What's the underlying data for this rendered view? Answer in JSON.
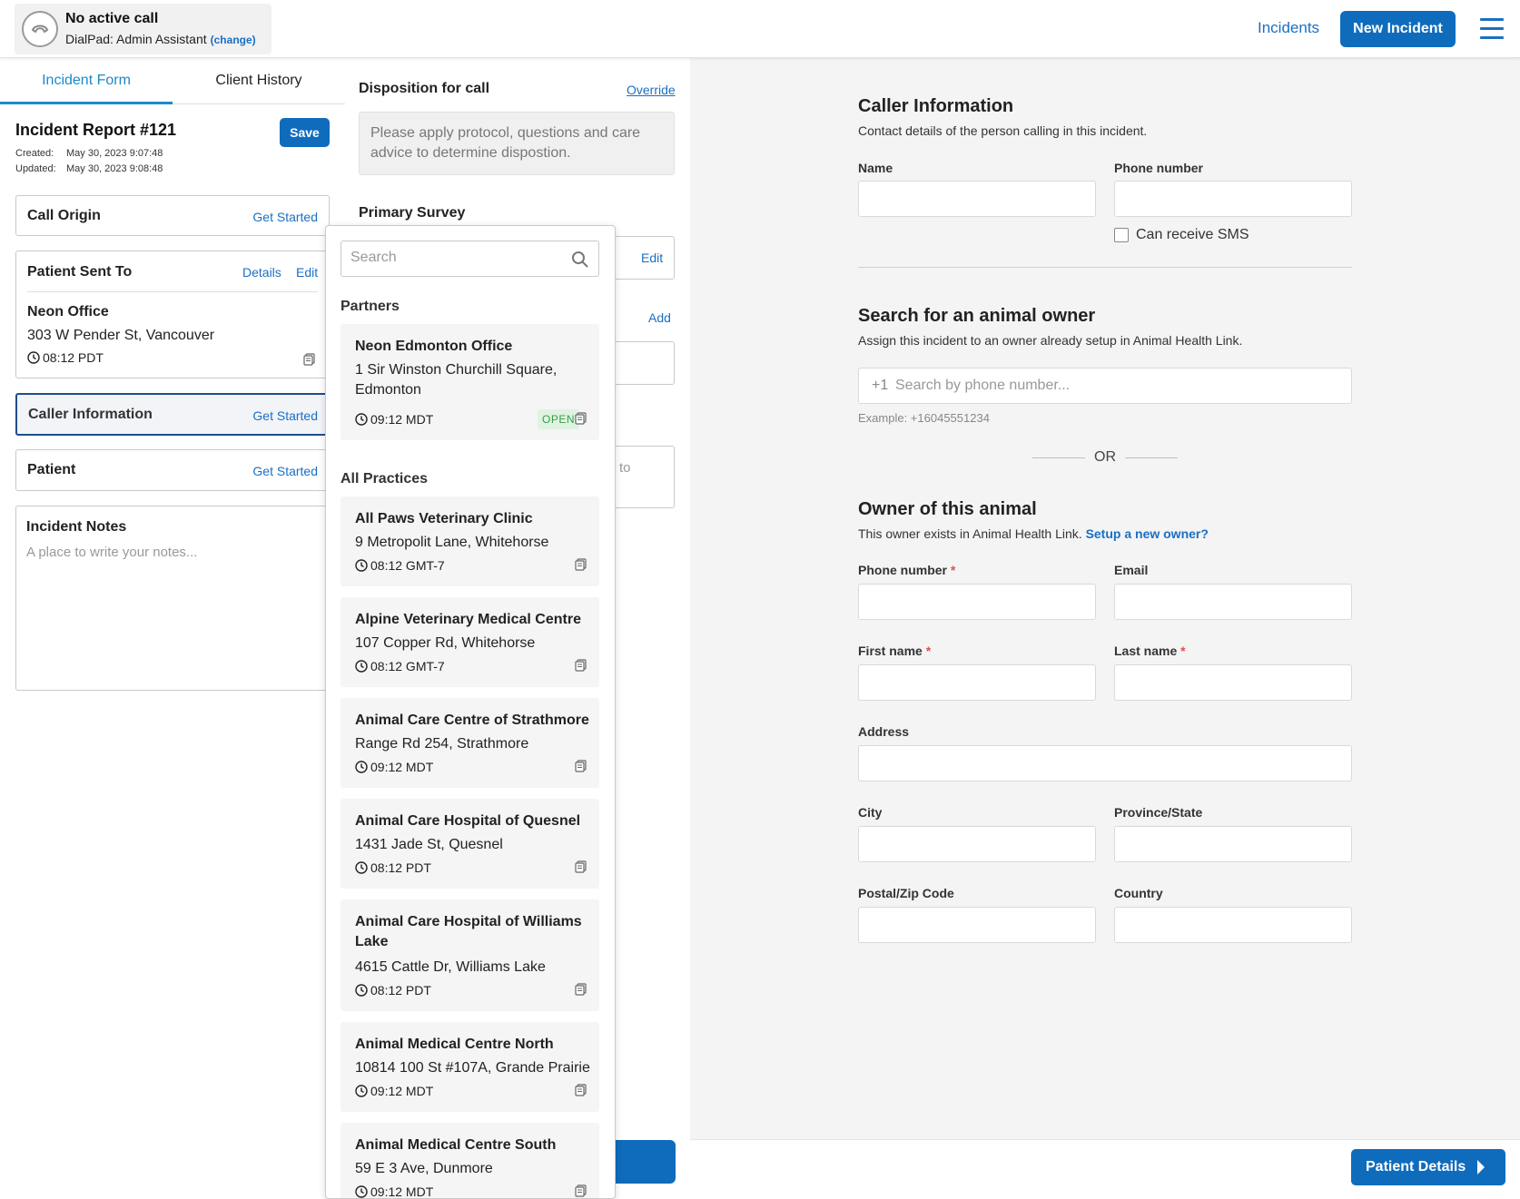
{
  "call": {
    "status": "No active call",
    "line": "DialPad: Admin Assistant",
    "change_label": "(change)"
  },
  "nav": {
    "incidents_label": "Incidents",
    "new_incident_label": "New Incident"
  },
  "tabs": {
    "incident_form": "Incident Form",
    "client_history": "Client History"
  },
  "report": {
    "title": "Incident Report #121",
    "created_label": "Created:",
    "created_value": "May 30, 2023 9:07:48",
    "updated_label": "Updated:",
    "updated_value": "May 30, 2023 9:08:48",
    "save_label": "Save"
  },
  "cards": {
    "call_origin": {
      "title": "Call Origin",
      "action": "Get Started"
    },
    "patient_sent_to": {
      "title": "Patient Sent To",
      "details": "Details",
      "edit": "Edit",
      "place_name": "Neon Office",
      "place_address": "303 W Pender St, Vancouver",
      "place_time": "08:12 PDT"
    },
    "caller_information": {
      "title": "Caller Information",
      "action": "Get Started"
    },
    "patient": {
      "title": "Patient",
      "action": "Get Started"
    },
    "incident_notes": {
      "title": "Incident Notes",
      "placeholder": "A place to write your notes..."
    }
  },
  "middle": {
    "disposition_title": "Disposition for call",
    "override_label": "Override",
    "disposition_text": "Please apply protocol, questions and care advice to determine dispostion.",
    "primary_survey_title": "Primary Survey",
    "edit_label": "Edit",
    "add_label": "Add",
    "partial_text": "to"
  },
  "dropdown": {
    "search_placeholder": "Search",
    "partners_label": "Partners",
    "partners": [
      {
        "name": "Neon Edmonton Office",
        "address": "1 Sir Winston Churchill Square, Edmonton",
        "time": "09:12 MDT",
        "badge": "OPEN"
      }
    ],
    "all_practices_label": "All Practices",
    "practices": [
      {
        "name": "All Paws Veterinary Clinic",
        "address": "9 Metropolit Lane, Whitehorse",
        "time": "08:12 GMT-7"
      },
      {
        "name": "Alpine Veterinary Medical Centre",
        "address": "107 Copper Rd, Whitehorse",
        "time": "08:12 GMT-7"
      },
      {
        "name": "Animal Care Centre of Strathmore",
        "address": "Range Rd 254, Strathmore",
        "time": "09:12 MDT"
      },
      {
        "name": "Animal Care Hospital of Quesnel",
        "address": "1431 Jade St, Quesnel",
        "time": "08:12 PDT"
      },
      {
        "name": "Animal Care Hospital of Williams Lake",
        "address": "4615 Cattle Dr, Williams Lake",
        "time": "08:12 PDT"
      },
      {
        "name": "Animal Medical Centre North",
        "address": "10814 100 St #107A, Grande Prairie",
        "time": "09:12 MDT"
      },
      {
        "name": "Animal Medical Centre South",
        "address": "59 E 3 Ave, Dunmore",
        "time": "09:12 MDT"
      }
    ]
  },
  "caller_info": {
    "title": "Caller Information",
    "subtitle": "Contact details of the person calling in this incident.",
    "name_label": "Name",
    "name_value": "",
    "phone_label": "Phone number",
    "phone_value": "",
    "sms_label": "Can receive SMS"
  },
  "owner_search": {
    "title": "Search for an animal owner",
    "subtitle": "Assign this incident to an owner already setup in Animal Health Link.",
    "prefix": "+1",
    "placeholder": "Search by phone number...",
    "example": "Example: +16045551234",
    "or_label": "OR"
  },
  "owner": {
    "title": "Owner of this animal",
    "subtitle": "This owner exists in Animal Health Link.",
    "setup_link": "Setup a new owner?",
    "phone_label": "Phone number",
    "email_label": "Email",
    "first_name_label": "First name",
    "last_name_label": "Last name",
    "address_label": "Address",
    "city_label": "City",
    "province_label": "Province/State",
    "postal_label": "Postal/Zip Code",
    "country_label": "Country",
    "required_mark": "*"
  },
  "footer": {
    "patient_details_label": "Patient Details"
  }
}
